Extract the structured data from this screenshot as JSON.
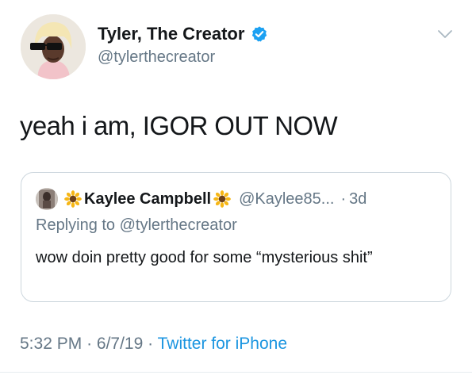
{
  "author": {
    "display_name": "Tyler, The Creator",
    "handle": "@tylerthecreator",
    "verified": true,
    "verified_icon": "verified-badge-icon"
  },
  "tweet": {
    "text": "yeah i am, IGOR OUT NOW",
    "time": "5:32 PM",
    "date": "6/7/19",
    "separator": "·",
    "source": "Twitter for iPhone"
  },
  "quoted_tweet": {
    "display_name": "Kaylee Campbell",
    "handle": "@Kaylee85...",
    "separator": "·",
    "age": "3d",
    "replying_to": "Replying to @tylerthecreator",
    "text": "wow doin pretty good for some “mysterious shit”",
    "name_decoration_icon": "sunflower-emoji-icon"
  },
  "colors": {
    "primary_text": "#14171a",
    "secondary_text": "#657786",
    "link": "#1b95e0",
    "verified": "#1da1f2",
    "border": "#ccd6dd"
  }
}
